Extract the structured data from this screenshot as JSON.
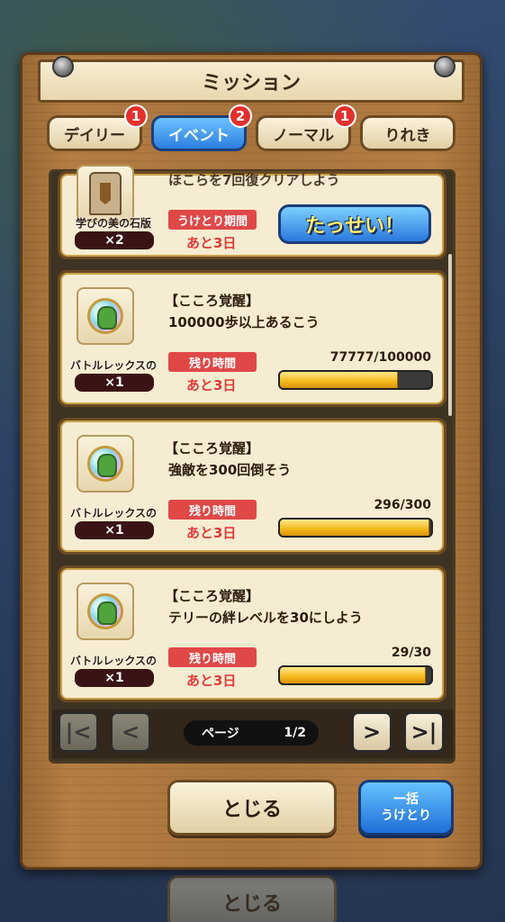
{
  "header": {
    "title": "ミッション"
  },
  "tabs": [
    {
      "label": "デイリー",
      "badge": "1",
      "active": false
    },
    {
      "label": "イベント",
      "badge": "2",
      "active": true
    },
    {
      "label": "ノーマル",
      "badge": "1",
      "active": false
    },
    {
      "label": "りれき",
      "badge": "",
      "active": false
    }
  ],
  "missions": [
    {
      "text": "ほこらを7回復クリアしよう",
      "item_name": "学びの美の石版",
      "quantity": "×2",
      "status_label": "うけとり期間",
      "remaining": "あと3日",
      "achieve_label": "たっせい！"
    },
    {
      "category": "【こころ覚醒】",
      "text": "100000歩以上あるこう",
      "item_name": "バトルレックスの宝珠",
      "quantity": "×1",
      "status_label": "残り時間",
      "remaining": "あと3日",
      "progress_text": "77777/100000",
      "progress": 0.77777
    },
    {
      "category": "【こころ覚醒】",
      "text": "強敵を300回倒そう",
      "item_name": "バトルレックスの宝珠",
      "quantity": "×1",
      "status_label": "残り時間",
      "remaining": "あと3日",
      "progress_text": "296/300",
      "progress": 0.9867
    },
    {
      "category": "【こころ覚醒】",
      "text": "テリーの絆レベルを30にしよう",
      "item_name": "バトルレックスの宝珠",
      "quantity": "×1",
      "status_label": "残り時間",
      "remaining": "あと3日",
      "progress_text": "29/30",
      "progress": 0.9667
    }
  ],
  "pager": {
    "label": "ページ",
    "value": "1/2",
    "first": "|<",
    "prev": "<",
    "next": ">",
    "last": ">|"
  },
  "footer": {
    "close_label": "とじる",
    "bulk_line1": "一括",
    "bulk_line2": "うけとり",
    "bg_close_label": "とじる"
  },
  "colors": {
    "board": "#b47d43",
    "active_tab": "#2c7fe0",
    "status_red": "#e04848",
    "bar_fill": "#f3b81a"
  }
}
